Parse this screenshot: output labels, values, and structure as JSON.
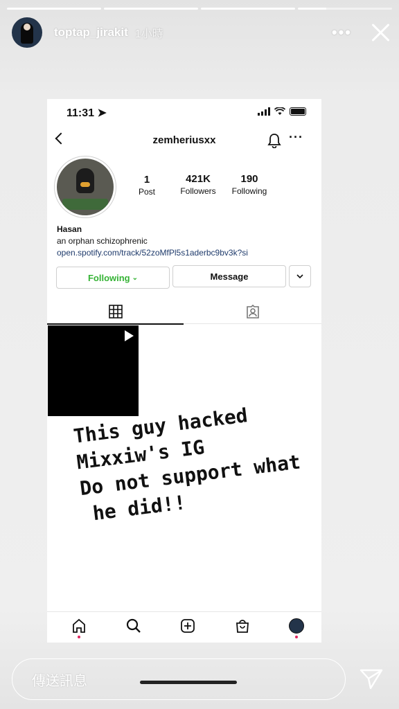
{
  "story": {
    "progress_segments": 4,
    "username": "toptap_jirakit",
    "time_ago": "1小時",
    "more_label": "•••"
  },
  "screenshot": {
    "status_time": "11:31",
    "profile_username": "zemheriusxx",
    "nav_more": "···",
    "stats": [
      {
        "num": "1",
        "label": "Post"
      },
      {
        "num": "421K",
        "label": "Followers"
      },
      {
        "num": "190",
        "label": "Following"
      }
    ],
    "bio": {
      "name": "Hasan",
      "description": "an orphan schizophrenic",
      "link": "open.spotify.com/track/52zoMfPl5s1aderbc9bv3k?si"
    },
    "buttons": {
      "following": "Following",
      "message": "Message"
    }
  },
  "overlay_text": [
    "This guy hacked",
    "Mixxiw's IG",
    "Do not support what",
    "he did!!"
  ],
  "reply": {
    "placeholder": "傳送訊息"
  }
}
